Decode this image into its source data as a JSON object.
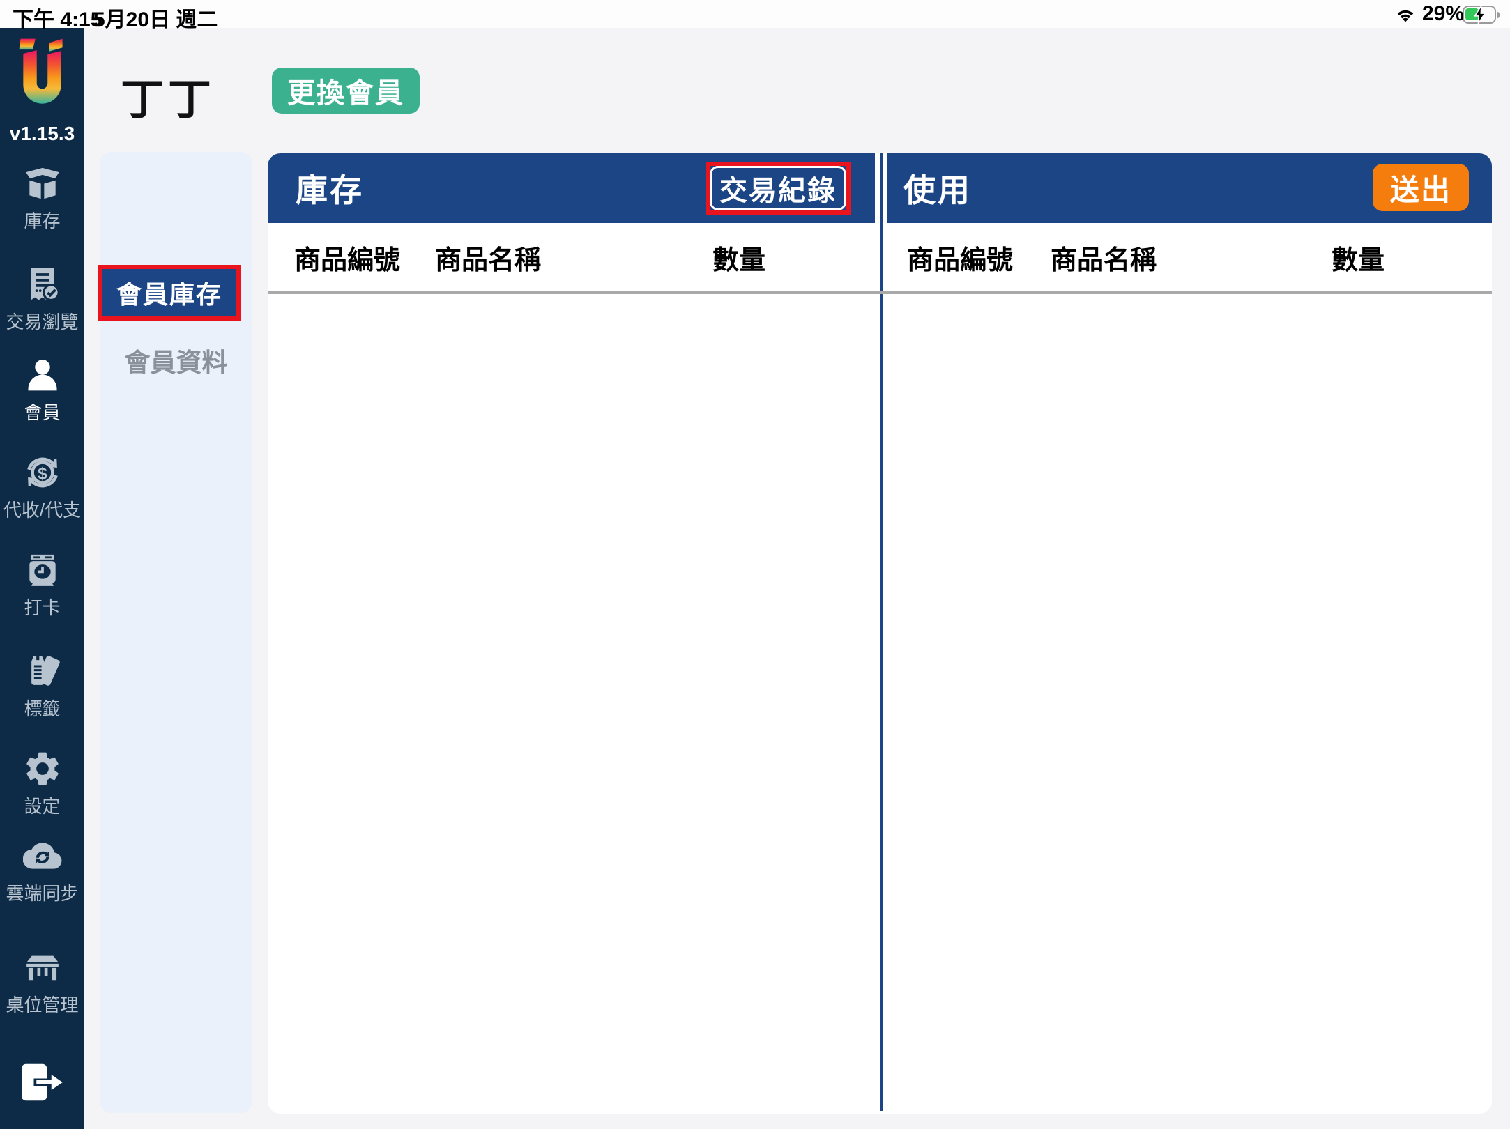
{
  "status_bar": {
    "time": "下午 4:15",
    "date": "5月20日 週二",
    "battery_percent": "29%",
    "icons": [
      "wifi-icon",
      "battery-charging-icon"
    ]
  },
  "sidebar": {
    "logo_icon": "u-gradient-logo",
    "version": "v1.15.3",
    "items": [
      {
        "label": "庫存",
        "icon": "inventory-box-icon",
        "active": false
      },
      {
        "label": "交易瀏覽",
        "icon": "receipt-check-icon",
        "active": false
      },
      {
        "label": "會員",
        "icon": "member-person-icon",
        "active": true
      },
      {
        "label": "代收/代支",
        "icon": "money-sync-icon",
        "active": false
      },
      {
        "label": "打卡",
        "icon": "punch-clock-icon",
        "active": false
      },
      {
        "label": "標籤",
        "icon": "tags-icon",
        "active": false
      },
      {
        "label": "設定",
        "icon": "gear-icon",
        "active": false
      },
      {
        "label": "雲端同步",
        "icon": "cloud-sync-icon",
        "active": false
      },
      {
        "label": "桌位管理",
        "icon": "table-icon",
        "active": false
      }
    ],
    "logout_icon": "logout-door-icon"
  },
  "header": {
    "member_name": "丁丁",
    "change_member_button": "更換會員"
  },
  "member_menu": {
    "profile_item": "會員資料",
    "inventory_item": "會員庫存"
  },
  "inventory_panel": {
    "title": "庫存",
    "transactions_button": "交易紀錄",
    "columns": [
      "商品編號",
      "商品名稱",
      "數量"
    ],
    "rows": []
  },
  "usage_panel": {
    "title": "使用",
    "submit_button": "送出",
    "columns": [
      "商品編號",
      "商品名稱",
      "數量"
    ],
    "rows": []
  },
  "colors": {
    "navy": "#0d2b47",
    "blue": "#1c4586",
    "light-panel": "#eaf1fb",
    "bg": "#f4f4f6",
    "green": "#3cb190",
    "orange": "#f57d0e",
    "red": "#e9141d",
    "icon-gray": "#b7c3ce",
    "label-gray": "#8a919b",
    "line-gray": "#a9a9a9"
  }
}
